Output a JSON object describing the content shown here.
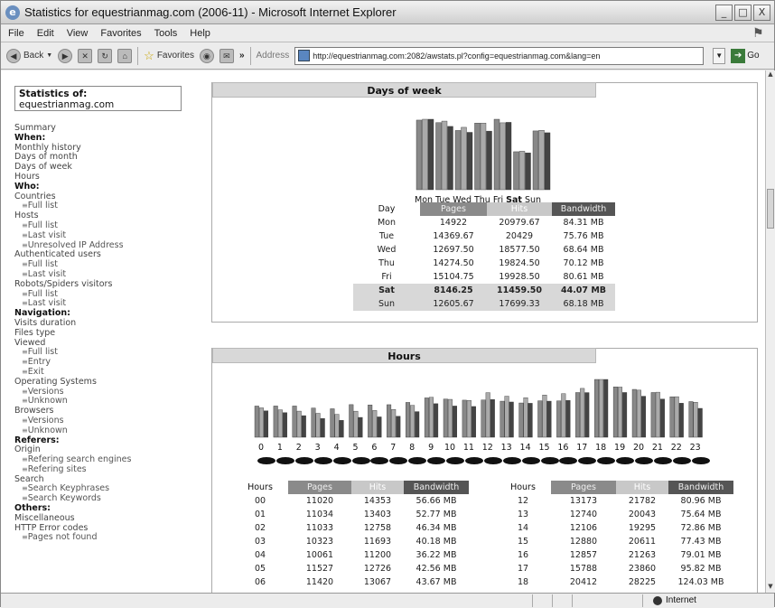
{
  "window": {
    "title": "Statistics for equestrianmag.com (2006-11) - Microsoft Internet Explorer",
    "buttons": [
      "_",
      "□",
      "X"
    ]
  },
  "menubar": [
    "File",
    "Edit",
    "View",
    "Favorites",
    "Tools",
    "Help"
  ],
  "toolbar": {
    "back": "Back",
    "favorites": "Favorites",
    "address_label": "Address",
    "url": "http://equestrianmag.com:2082/awstats.pl?config=equestrianmag.com&lang=en",
    "go": "Go",
    "chevron": "»"
  },
  "sidebar": {
    "site_label": "Statistics of:",
    "site_name": "equestrianmag.com",
    "items": [
      {
        "t": "Summary",
        "k": "link"
      },
      {
        "t": "When:",
        "k": "hdr"
      },
      {
        "t": "Monthly history",
        "k": "link"
      },
      {
        "t": "Days of month",
        "k": "link"
      },
      {
        "t": "Days of week",
        "k": "link"
      },
      {
        "t": "Hours",
        "k": "link"
      },
      {
        "t": "Who:",
        "k": "hdr"
      },
      {
        "t": "Countries",
        "k": "link"
      },
      {
        "t": "Full list",
        "k": "sub"
      },
      {
        "t": "Hosts",
        "k": "link"
      },
      {
        "t": "Full list",
        "k": "sub"
      },
      {
        "t": "Last visit",
        "k": "sub"
      },
      {
        "t": "Unresolved IP Address",
        "k": "sub"
      },
      {
        "t": "Authenticated users",
        "k": "link"
      },
      {
        "t": "Full list",
        "k": "sub"
      },
      {
        "t": "Last visit",
        "k": "sub"
      },
      {
        "t": "Robots/Spiders visitors",
        "k": "link"
      },
      {
        "t": "Full list",
        "k": "sub"
      },
      {
        "t": "Last visit",
        "k": "sub"
      },
      {
        "t": "Navigation:",
        "k": "hdr"
      },
      {
        "t": "Visits duration",
        "k": "link"
      },
      {
        "t": "Files type",
        "k": "link"
      },
      {
        "t": "Viewed",
        "k": "link"
      },
      {
        "t": "Full list",
        "k": "sub"
      },
      {
        "t": "Entry",
        "k": "sub"
      },
      {
        "t": "Exit",
        "k": "sub"
      },
      {
        "t": "Operating Systems",
        "k": "link"
      },
      {
        "t": "Versions",
        "k": "sub"
      },
      {
        "t": "Unknown",
        "k": "sub"
      },
      {
        "t": "Browsers",
        "k": "link"
      },
      {
        "t": "Versions",
        "k": "sub"
      },
      {
        "t": "Unknown",
        "k": "sub"
      },
      {
        "t": "Referers:",
        "k": "hdr"
      },
      {
        "t": "Origin",
        "k": "link"
      },
      {
        "t": "Refering search engines",
        "k": "sub"
      },
      {
        "t": "Refering sites",
        "k": "sub"
      },
      {
        "t": "Search",
        "k": "link"
      },
      {
        "t": "Search Keyphrases",
        "k": "sub"
      },
      {
        "t": "Search Keywords",
        "k": "sub"
      },
      {
        "t": "Others:",
        "k": "hdr"
      },
      {
        "t": "Miscellaneous",
        "k": "link"
      },
      {
        "t": "HTTP Error codes",
        "k": "link"
      },
      {
        "t": "Pages not found",
        "k": "sub"
      }
    ]
  },
  "days_panel": {
    "title": "Days of week",
    "headers": [
      "Day",
      "Pages",
      "Hits",
      "Bandwidth"
    ],
    "rows": [
      [
        "Mon",
        "14922",
        "20979.67",
        "84.31 MB"
      ],
      [
        "Tue",
        "14369.67",
        "20429",
        "75.76 MB"
      ],
      [
        "Wed",
        "12697.50",
        "18577.50",
        "68.64 MB"
      ],
      [
        "Thu",
        "14274.50",
        "19824.50",
        "70.12 MB"
      ],
      [
        "Fri",
        "15104.75",
        "19928.50",
        "80.61 MB"
      ],
      [
        "Sat",
        "8146.25",
        "11459.50",
        "44.07 MB"
      ],
      [
        "Sun",
        "12605.67",
        "17699.33",
        "68.18 MB"
      ]
    ]
  },
  "hours_panel": {
    "title": "Hours",
    "headers": [
      "Hours",
      "Pages",
      "Hits",
      "Bandwidth"
    ],
    "left_rows": [
      [
        "00",
        "11020",
        "14353",
        "56.66 MB"
      ],
      [
        "01",
        "11034",
        "13403",
        "52.77 MB"
      ],
      [
        "02",
        "11033",
        "12758",
        "46.34 MB"
      ],
      [
        "03",
        "10323",
        "11693",
        "40.18 MB"
      ],
      [
        "04",
        "10061",
        "11200",
        "36.22 MB"
      ],
      [
        "05",
        "11527",
        "12726",
        "42.56 MB"
      ],
      [
        "06",
        "11420",
        "13067",
        "43.67 MB"
      ]
    ],
    "right_rows": [
      [
        "12",
        "13173",
        "21782",
        "80.96 MB"
      ],
      [
        "13",
        "12740",
        "20043",
        "75.64 MB"
      ],
      [
        "14",
        "12106",
        "19295",
        "72.86 MB"
      ],
      [
        "15",
        "12880",
        "20611",
        "77.43 MB"
      ],
      [
        "16",
        "12857",
        "21263",
        "79.01 MB"
      ],
      [
        "17",
        "15788",
        "23860",
        "95.82 MB"
      ],
      [
        "18",
        "20412",
        "28225",
        "124.03 MB"
      ]
    ]
  },
  "chart_data": [
    {
      "type": "bar",
      "categories": [
        "Mon",
        "Tue",
        "Wed",
        "Thu",
        "Fri",
        "Sat",
        "Sun"
      ],
      "series": [
        {
          "name": "Pages",
          "values": [
            14922,
            14369.67,
            12697.5,
            14274.5,
            15104.75,
            8146.25,
            12605.67
          ]
        },
        {
          "name": "Hits",
          "values": [
            20979.67,
            20429,
            18577.5,
            19824.5,
            19928.5,
            11459.5,
            17699.33
          ]
        },
        {
          "name": "Bandwidth",
          "values": [
            84.31,
            75.76,
            68.64,
            70.12,
            80.61,
            44.07,
            68.18
          ]
        }
      ],
      "colors": [
        "#888888",
        "#aaaaaa",
        "#444444"
      ]
    },
    {
      "type": "bar",
      "categories": [
        "0",
        "1",
        "2",
        "3",
        "4",
        "5",
        "6",
        "7",
        "8",
        "9",
        "10",
        "11",
        "12",
        "13",
        "14",
        "15",
        "16",
        "17",
        "18",
        "19",
        "20",
        "21",
        "22",
        "23"
      ],
      "series": [
        {
          "name": "Pages",
          "values": [
            11020,
            11034,
            11033,
            10323,
            10061,
            11527,
            11420,
            11500,
            12300,
            13900,
            13500,
            13100,
            13173,
            12740,
            12106,
            12880,
            12857,
            15788,
            20412,
            17800,
            16900,
            15800,
            14300,
            12600
          ]
        },
        {
          "name": "Hits",
          "values": [
            14353,
            13403,
            12758,
            11693,
            11200,
            12726,
            13067,
            13600,
            15600,
            19500,
            18500,
            18000,
            21782,
            20043,
            19295,
            20611,
            21263,
            23860,
            28225,
            24500,
            23000,
            22000,
            19800,
            17100
          ]
        },
        {
          "name": "Bandwidth",
          "values": [
            56.66,
            52.77,
            46.34,
            40.18,
            36.22,
            42.56,
            43.67,
            45,
            55,
            72,
            67,
            66,
            80.96,
            75.64,
            72.86,
            77.43,
            79.01,
            95.82,
            124.03,
            96,
            88,
            82,
            73,
            62
          ]
        }
      ],
      "colors": [
        "#888888",
        "#aaaaaa",
        "#444444"
      ]
    }
  ],
  "status": {
    "left": "",
    "zone": "Internet"
  },
  "icons": [
    "ie-logo-icon",
    "back-icon",
    "forward-icon",
    "stop-icon",
    "refresh-icon",
    "home-icon",
    "favorites-star-icon",
    "media-icon",
    "mail-icon",
    "page-icon",
    "go-arrow-icon",
    "globe-icon",
    "windows-flag-icon"
  ]
}
